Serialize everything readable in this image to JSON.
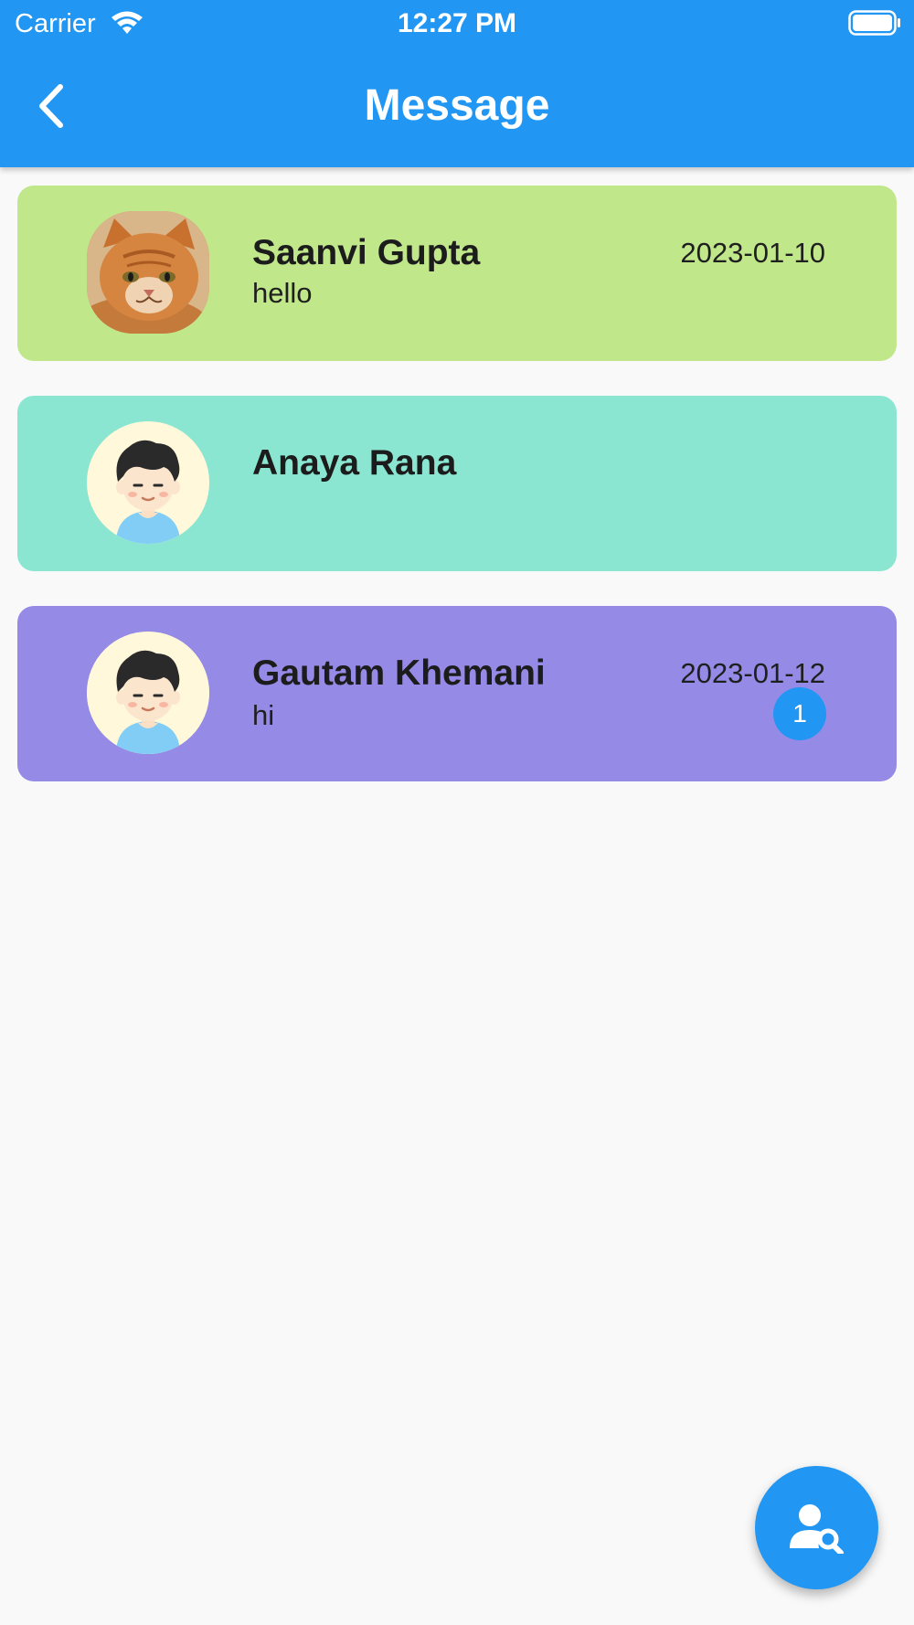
{
  "status_bar": {
    "carrier": "Carrier",
    "time": "12:27 PM",
    "icons": [
      "wifi-icon",
      "battery-icon"
    ]
  },
  "header": {
    "title": "Message",
    "back_icon": "chevron-left-icon",
    "background": "#2196f3"
  },
  "conversations": [
    {
      "name": "Saanvi Gupta",
      "preview": "hello",
      "date": "2023-01-10",
      "unread": "",
      "avatar": "cat-photo",
      "color": "#c1e78b"
    },
    {
      "name": "Anaya Rana",
      "preview": "",
      "date": "",
      "unread": "",
      "avatar": "boy-cartoon-avatar",
      "color": "#8ae6d1"
    },
    {
      "name": "Gautam Khemani",
      "preview": "hi",
      "date": "2023-01-12",
      "unread": "1",
      "avatar": "boy-cartoon-avatar",
      "color": "#958be6"
    }
  ],
  "fab": {
    "icon": "user-search-icon",
    "color": "#2196f3"
  }
}
